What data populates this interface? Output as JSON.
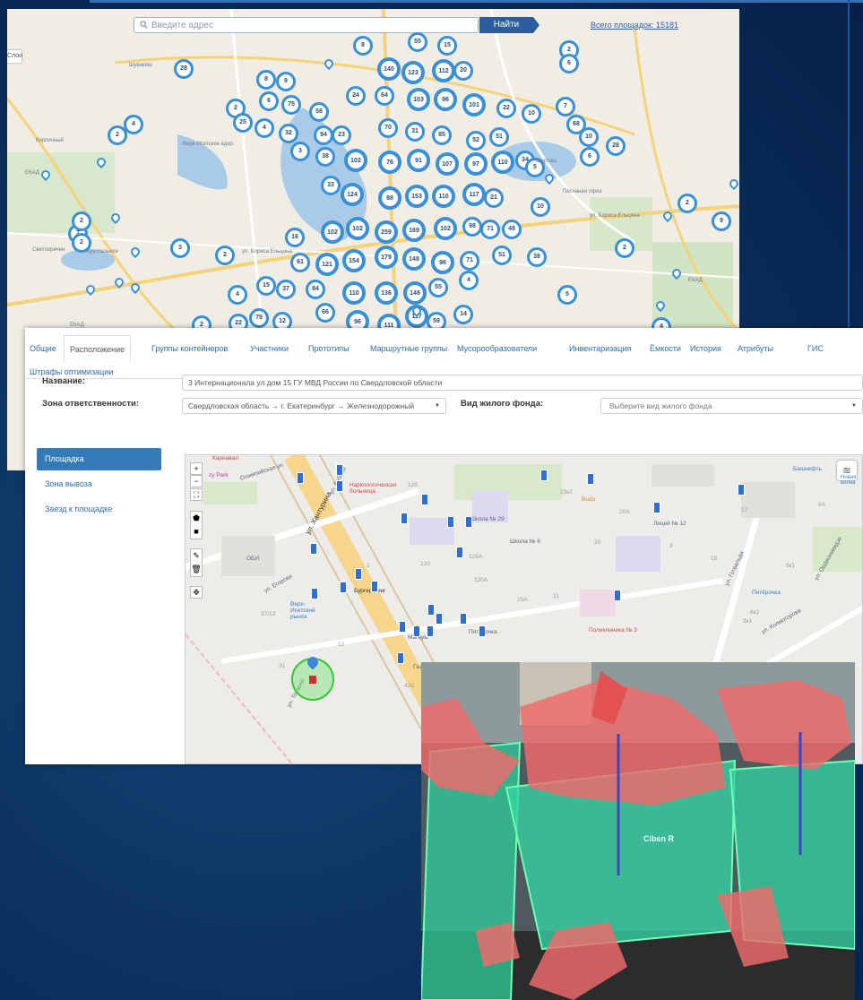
{
  "map_overview": {
    "search_placeholder": "Введите адрес",
    "search_button": "Найти",
    "total_link": "Всего площадок: 15181",
    "side_tab": "Слои",
    "clusters": [
      "8",
      "55",
      "15",
      "2",
      "28",
      "140",
      "123",
      "112",
      "20",
      "6",
      "8",
      "9",
      "2",
      "6",
      "75",
      "58",
      "24",
      "64",
      "103",
      "96",
      "101",
      "22",
      "10",
      "7",
      "25",
      "4",
      "2",
      "4",
      "32",
      "94",
      "23",
      "70",
      "31",
      "85",
      "52",
      "51",
      "68",
      "10",
      "28",
      "3",
      "38",
      "102",
      "76",
      "91",
      "107",
      "97",
      "110",
      "34",
      "6",
      "5",
      "33",
      "124",
      "88",
      "153",
      "110",
      "117",
      "21",
      "10",
      "2",
      "9",
      "7",
      "2",
      "102",
      "102",
      "259",
      "169",
      "102",
      "98",
      "71",
      "49",
      "16",
      "2",
      "3",
      "2",
      "61",
      "121",
      "154",
      "179",
      "148",
      "96",
      "71",
      "51",
      "38",
      "2",
      "15",
      "37",
      "84",
      "110",
      "136",
      "146",
      "55",
      "4",
      "5",
      "4",
      "66",
      "96",
      "117",
      "59",
      "14",
      "4",
      "2",
      "22",
      "79",
      "12",
      "111"
    ],
    "places": [
      "Верх-Исетское вдхр.",
      "Хрустальное",
      "Шарташ",
      "Песчаная горка",
      "Светлоречен",
      "Кирпичный",
      "Шувакиш"
    ],
    "roads": [
      "ЕКАД",
      "ЕКАД",
      "ЕКАД",
      "ул. Бориса Ельцина",
      "ул. Бориса Ельцина"
    ]
  },
  "tabs": [
    "Общие",
    "Расположение",
    "Группы контейнеров",
    "Участники",
    "Прототипы",
    "Маршрутные группы",
    "Мусорообразователи",
    "Инвентаризация",
    "Ёмкости",
    "История",
    "Атрибуты",
    "ГИС",
    "Штрафы оптимизации"
  ],
  "form": {
    "name_label": "Название:",
    "name_value": "3 Интернационала ул дом 15 ГУ МВД России по Свердловской области",
    "zone_label": "Зона ответственности:",
    "zone_value": "Свердловская область → г. Екатеринбург → Железнодорожный",
    "housing_label": "Вид жилого фонда:",
    "housing_placeholder": "Выберите вид жилого фонда"
  },
  "side_menu": [
    "Площадка",
    "Зона вывоза",
    "Заезд к площадке"
  ],
  "map_detail": {
    "controls": [
      "+",
      "−"
    ],
    "labels": {
      "karnaval": "Карнавал",
      "party": "zy Park",
      "olimp": "Олимпийская ул.",
      "hantyr": "ул. Хантурина",
      "bebel": "ул. Бебеля",
      "narko": "Наркологическая больница",
      "school29": "Школа № 29",
      "school6": "Школа № 6",
      "budo": "Budo",
      "lyceum": "Лицей № 12",
      "bashneft": "Башнефть",
      "obi": "ОБИ",
      "egorova": "ул. Егорова",
      "burger": "Бургер Кинг",
      "verh": "Верх-Исетский рынок",
      "magnum": "Магнум",
      "pyaterochka": "Пятерочка",
      "pyaterochka2": "Пятёрочка",
      "poliklinika": "Поликлиника № 3",
      "gotvald": "ул. Готвальда",
      "kolmogorova": "ул. Колмогорова",
      "ordzhon": "ул. Орджоникидзе",
      "tokarey": "ул. Токарей",
      "gaz": "Газ",
      "volna": "Новая волна"
    },
    "houses": [
      "12б",
      "23к2",
      "20А",
      "6А",
      "17",
      "48",
      "120",
      "126А",
      "120А",
      "25А",
      "21",
      "15",
      "9к1",
      "6к2",
      "6к1",
      "37/13",
      "43б",
      "31",
      "12",
      "1",
      "3",
      "20"
    ]
  },
  "photo": {
    "brand": "Ciben R"
  }
}
